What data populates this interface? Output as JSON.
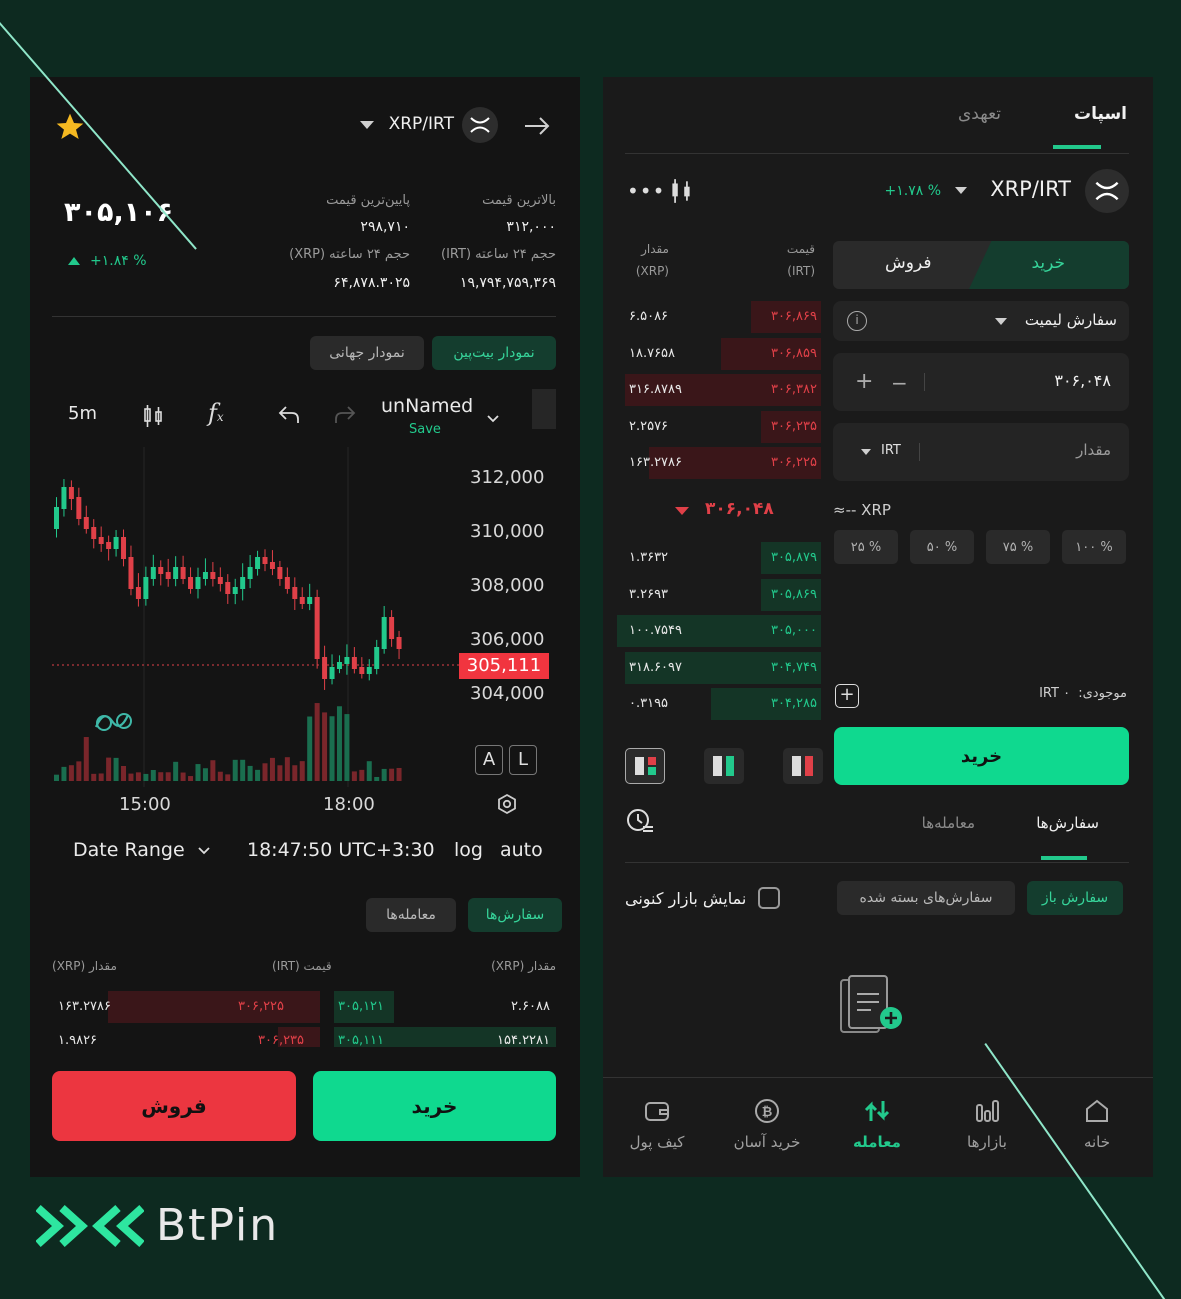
{
  "left": {
    "pair": "XRP/IRT",
    "price": "۳۰۵,۱۰۶",
    "change": "+۱.۸۴ %",
    "stats": {
      "high_label": "بالاترین قیمت",
      "high_value": "۳۱۲,۰۰۰",
      "low_label": "پایین‌ترین قیمت",
      "low_value": "۲۹۸,۷۱۰",
      "vol_irt_label": "حجم ۲۴ ساعته (IRT)",
      "vol_irt_value": "۱۹,۷۹۴,۷۵۹,۳۶۹",
      "vol_xrp_label": "حجم ۲۴ ساعته (XRP)",
      "vol_xrp_value": "۶۴,۸۷۸.۳۰۲۵"
    },
    "chart_tabs": [
      "نمودار بیت‌پین",
      "نمودار جهانی"
    ],
    "toolbar": {
      "interval": "5m",
      "layout_name": "unNamed",
      "save": "Save"
    },
    "price_axis": [
      "312,000",
      "310,000",
      "308,000",
      "306,000",
      "304,000"
    ],
    "current_price_tag": "305,111",
    "time_axis": [
      "15:00",
      "18:00"
    ],
    "scale_buttons": [
      "A",
      "L"
    ],
    "footer": {
      "date_range": "Date Range",
      "clock": "18:47:50 UTC+3:30",
      "log": "log",
      "auto": "auto"
    },
    "order_tabs": [
      "سفارش‌ها",
      "معامله‌ها"
    ],
    "book_headers": {
      "buy_amount": "مقدار (XRP)",
      "price": "قیمت (IRT)",
      "sell_amount": "مقدار (XRP)"
    },
    "book_rows": [
      {
        "buy_amount": "۲.۶۰۸۸",
        "buy_price": "۳۰۵,۱۲۱",
        "sell_price": "۳۰۶,۲۲۵",
        "sell_amount": "۱۶۳.۲۷۸۶"
      },
      {
        "buy_amount": "۱۵۴.۲۲۸۱",
        "buy_price": "۳۰۵,۱۱۱",
        "sell_price": "۳۰۶,۲۳۵",
        "sell_amount": "۱.۹۸۲۶"
      }
    ],
    "buy": "خرید",
    "sell": "فروش"
  },
  "right": {
    "tabs": [
      "اسپات",
      "تعهدی"
    ],
    "pair": "XRP/IRT",
    "change": "+۱.۷۸ %",
    "book_headers": {
      "price": "قیمت",
      "price_unit": "(IRT)",
      "amount": "مقدار",
      "amount_unit": "(XRP)"
    },
    "asks": [
      {
        "price": "۳۰۶,۸۶۹",
        "amount": "۶.۵۰۸۶"
      },
      {
        "price": "۳۰۶,۸۵۹",
        "amount": "۱۸.۷۶۵۸"
      },
      {
        "price": "۳۰۶,۳۸۲",
        "amount": "۳۱۶.۸۷۸۹"
      },
      {
        "price": "۳۰۶,۲۳۵",
        "amount": "۲.۲۵۷۶"
      },
      {
        "price": "۳۰۶,۲۲۵",
        "amount": "۱۶۳.۲۷۸۶"
      }
    ],
    "mid_price": "۳۰۶,۰۴۸",
    "bids": [
      {
        "price": "۳۰۵,۸۷۹",
        "amount": "۱.۳۶۳۲"
      },
      {
        "price": "۳۰۵,۸۶۹",
        "amount": "۳.۲۶۹۳"
      },
      {
        "price": "۳۰۵,۰۰۰",
        "amount": "۱۰۰.۷۵۴۹"
      },
      {
        "price": "۳۰۴,۷۴۹",
        "amount": "۳۱۸.۶۰۹۷"
      },
      {
        "price": "۳۰۴,۲۸۵",
        "amount": "۰.۳۱۹۵"
      }
    ],
    "side_buy": "خرید",
    "side_sell": "فروش",
    "order_type": "سفارش لیمیت",
    "price_value": "۳۰۶,۰۴۸",
    "amount_placeholder": "مقدار",
    "amount_unit": "IRT",
    "approx": "≈-- XRP",
    "percents": [
      "۱۰۰ %",
      "۷۵ %",
      "۵۰ %",
      "۲۵ %"
    ],
    "balance_label": "موجودی:",
    "balance_value": "IRT ۰",
    "submit": "خرید",
    "order_tabs": [
      "سفارش‌ها",
      "معامله‌ها"
    ],
    "filters": [
      "سفارش باز",
      "سفارش‌های بسته شده"
    ],
    "show_current": "نمایش بازار کنونی",
    "nav": [
      "خانه",
      "بازارها",
      "معامله",
      "خرید آسان",
      "کیف پول"
    ]
  },
  "brand": "BtPin",
  "colors": {
    "bg": "#0d2a20",
    "accent": "#0fd98f",
    "sell": "#ec3640",
    "up": "#22c98c",
    "down": "#e04048"
  }
}
